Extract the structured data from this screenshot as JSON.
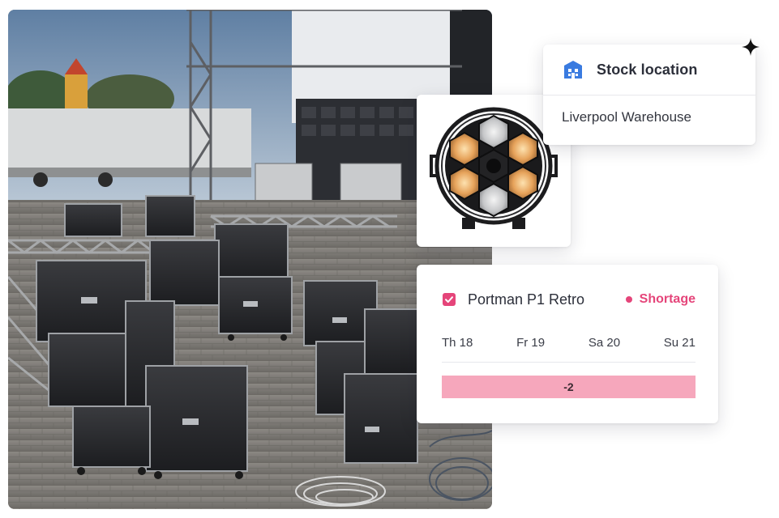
{
  "stock_location": {
    "title": "Stock location",
    "value": "Liverpool Warehouse",
    "icon": "warehouse-icon",
    "icon_color": "#3a7be0"
  },
  "fixture": {
    "icon": "stage-light-fixture-icon"
  },
  "availability": {
    "product_name": "Portman P1 Retro",
    "checked": true,
    "status_label": "Shortage",
    "status_color": "#e5457a",
    "days": [
      "Th 18",
      "Fr 19",
      "Sa 20",
      "Su 21"
    ],
    "shortage_value": "-2",
    "bar_color": "#f6a7bc"
  },
  "decoration": {
    "icon": "sparkle-icon"
  },
  "background_photo": {
    "subject": "flight cases and truss at outdoor event setup"
  }
}
